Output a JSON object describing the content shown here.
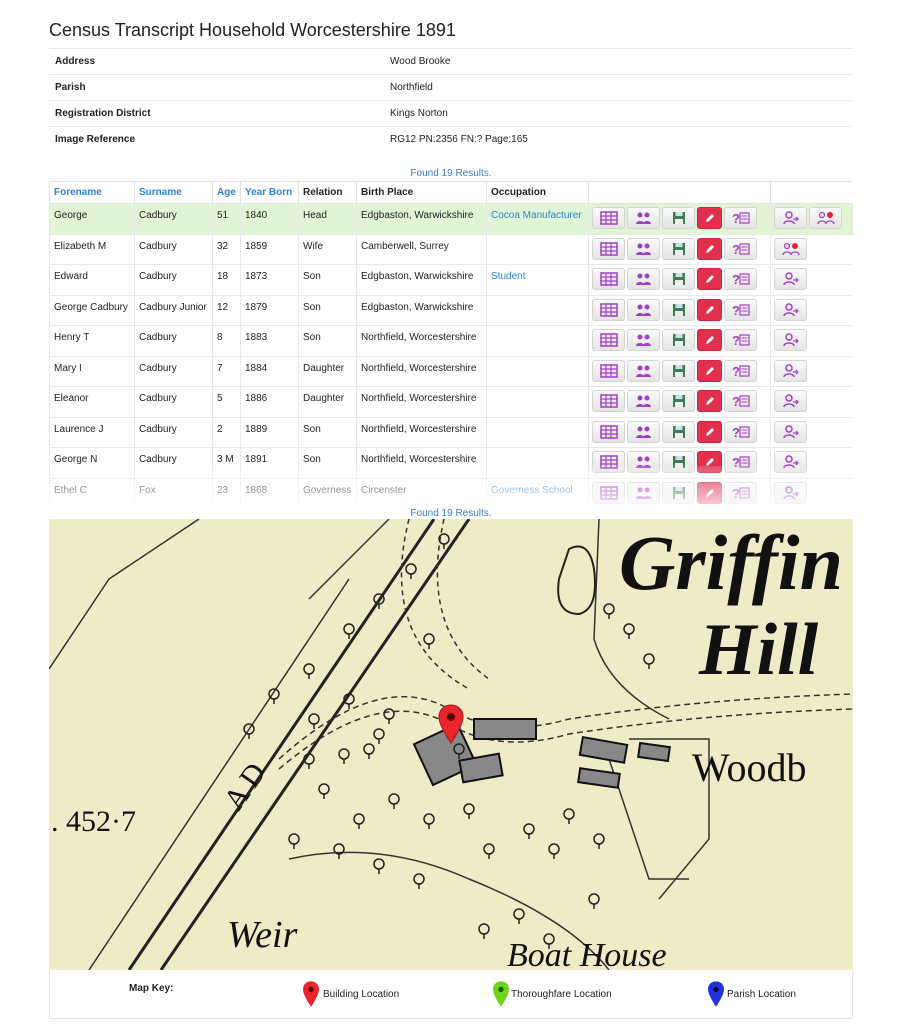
{
  "page_title": "Census Transcript Household Worcestershire 1891",
  "info": [
    {
      "label": "Address",
      "value": "Wood Brooke"
    },
    {
      "label": "Parish",
      "value": "Northfield"
    },
    {
      "label": "Registration District",
      "value": "Kings Norton"
    },
    {
      "label": "Image Reference",
      "value": "RG12 PN:2356 FN:? Page:165"
    }
  ],
  "found_text": "Found 19 Results.",
  "columns": [
    "Forename",
    "Surname",
    "Age",
    "Year Born",
    "Relation",
    "Birth Place",
    "Occupation"
  ],
  "rows": [
    [
      "George",
      "Cadbury",
      "51",
      "1840",
      "Head",
      "Edgbaston, Warwickshire",
      "Cocoa Manufacturer"
    ],
    [
      "Elizabeth M",
      "Cadbury",
      "32",
      "1859",
      "Wife",
      "Camberwell, Surrey",
      ""
    ],
    [
      "Edward",
      "Cadbury",
      "18",
      "1873",
      "Son",
      "Edgbaston, Warwickshire",
      "Student"
    ],
    [
      "George Cadbury",
      "Cadbury Junior",
      "12",
      "1879",
      "Son",
      "Edgbaston, Warwickshire",
      ""
    ],
    [
      "Henry T",
      "Cadbury",
      "8",
      "1883",
      "Son",
      "Northfield, Worcestershire",
      ""
    ],
    [
      "Mary I",
      "Cadbury",
      "7",
      "1884",
      "Daughter",
      "Northfield, Worcestershire",
      ""
    ],
    [
      "Eleanor",
      "Cadbury",
      "5",
      "1886",
      "Daughter",
      "Northfield, Worcestershire",
      ""
    ],
    [
      "Laurence J",
      "Cadbury",
      "2",
      "1889",
      "Son",
      "Northfield, Worcestershire",
      ""
    ],
    [
      "George N",
      "Cadbury",
      "3 M",
      "1891",
      "Son",
      "Northfield, Worcestershire",
      ""
    ],
    [
      "Ethel C",
      "Fox",
      "23",
      "1868",
      "Governess",
      "Circenster",
      "Governess School"
    ]
  ],
  "map_labels": {
    "griffin": "Griffin",
    "hill": "Hill",
    "woodbrooke": "Woodb",
    "weir": "Weir",
    "boathouse": "Boat House",
    "spot_height": ". 452·7",
    "road_letters": "A D"
  },
  "map_key": {
    "title": "Map Key:",
    "items": [
      {
        "label": "Building Location",
        "color": "#e8262b"
      },
      {
        "label": "Thoroughfare Location",
        "color": "#6fd21c"
      },
      {
        "label": "Parish Location",
        "color": "#2233dd"
      }
    ]
  },
  "colors": {
    "link": "#2e83d6",
    "highlight_row": "#dff5d3",
    "edit_button": "#e0304e",
    "icon_purple": "#a23ec4"
  }
}
